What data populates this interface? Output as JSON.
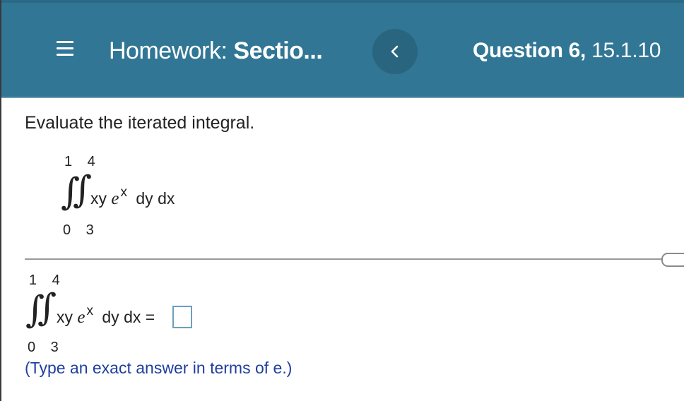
{
  "header": {
    "title_prefix": "Homework:",
    "title_bold": "Sectio...",
    "question_bold": "Question 6,",
    "question_id": "15.1.10",
    "back_icon": "chevron-left-icon",
    "menu_icon": "hamburger-menu-icon",
    "colors": {
      "background": "#317795",
      "back_button": "#2a6580",
      "text": "#ffffff"
    }
  },
  "question": {
    "prompt": "Evaluate the iterated integral.",
    "integral": {
      "upper_limits": "1 4",
      "lower_limits": "0 3",
      "integrand_xy": "xy",
      "integrand_e": "e",
      "exponent": "x",
      "differentials": "dy dx"
    }
  },
  "answer": {
    "upper_limits": "1 4",
    "lower_limits": "0 3",
    "integrand_xy": "xy",
    "integrand_e": "e",
    "exponent": "x",
    "differentials_equals": "dy dx =",
    "value": "",
    "hint": "(Type an exact answer in terms of e.)",
    "colors": {
      "hint": "#1f3f9e",
      "box_border": "#6d9fc0"
    }
  }
}
